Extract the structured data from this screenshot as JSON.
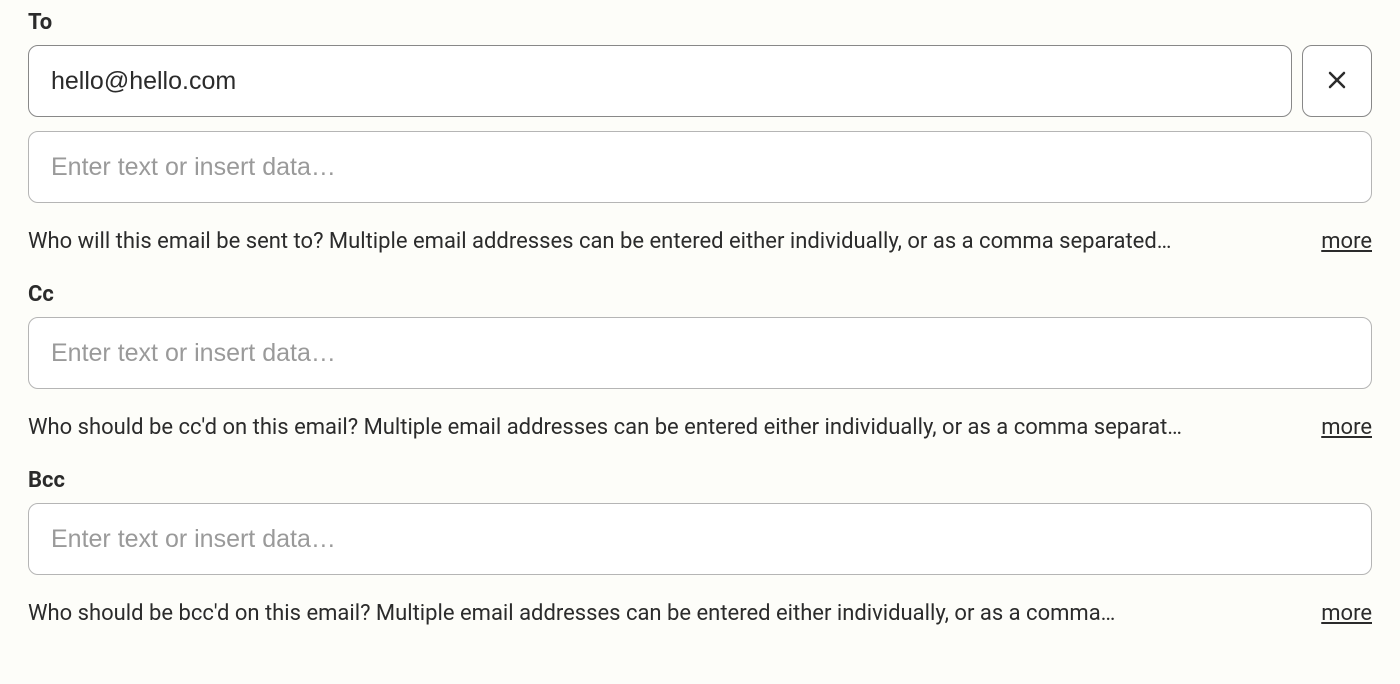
{
  "to": {
    "label": "To",
    "value": "hello@hello.com",
    "placeholder_extra": "Enter text or insert data…",
    "help": "Who will this email be sent to? Multiple email addresses can be entered either individually, or as a comma separated…",
    "more": "more"
  },
  "cc": {
    "label": "Cc",
    "placeholder": "Enter text or insert data…",
    "help": "Who should be cc'd on this email? Multiple email addresses can be entered either individually, or as a comma separat…",
    "more": "more"
  },
  "bcc": {
    "label": "Bcc",
    "placeholder": "Enter text or insert data…",
    "help": "Who should be bcc'd on this email? Multiple email addresses can be entered either individually, or as a comma…",
    "more": "more"
  }
}
